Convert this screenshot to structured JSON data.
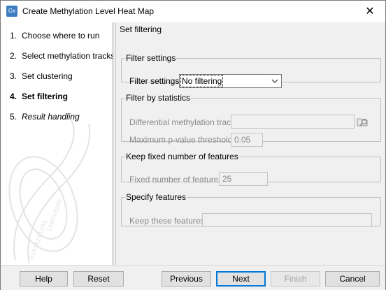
{
  "window": {
    "title": "Create Methylation Level Heat Map",
    "app_icon_text": "Gx",
    "close_glyph": "✕"
  },
  "steps": [
    {
      "num": "1.",
      "label": "Choose where to run",
      "state": "normal"
    },
    {
      "num": "2.",
      "label": "Select methylation tracks",
      "state": "normal"
    },
    {
      "num": "3.",
      "label": "Set clustering",
      "state": "normal"
    },
    {
      "num": "4.",
      "label": "Set filtering",
      "state": "current"
    },
    {
      "num": "5.",
      "label": "Result handling",
      "state": "italic"
    }
  ],
  "page": {
    "title": "Set filtering"
  },
  "filter_settings": {
    "legend": "Filter settings",
    "label": "Filter settings",
    "value": "No filtering"
  },
  "filter_by_statistics": {
    "legend": "Filter by statistics",
    "track_label": "Differential methylation track",
    "track_value": "",
    "pvalue_label": "Maximum p-value threshold",
    "pvalue_value": "0.05"
  },
  "keep_fixed": {
    "legend": "Keep fixed number of features",
    "label": "Fixed number of features",
    "value": "25"
  },
  "specify_features": {
    "legend": "Specify features",
    "label": "Keep these features",
    "value": ""
  },
  "buttons": {
    "help": "Help",
    "reset": "Reset",
    "previous": "Previous",
    "next": "Next",
    "finish": "Finish",
    "cancel": "Cancel"
  },
  "icons": {
    "browse": "browse-folder-icon",
    "dropdown": "chevron-down-icon",
    "watermark": "dna-watermark-icon"
  }
}
